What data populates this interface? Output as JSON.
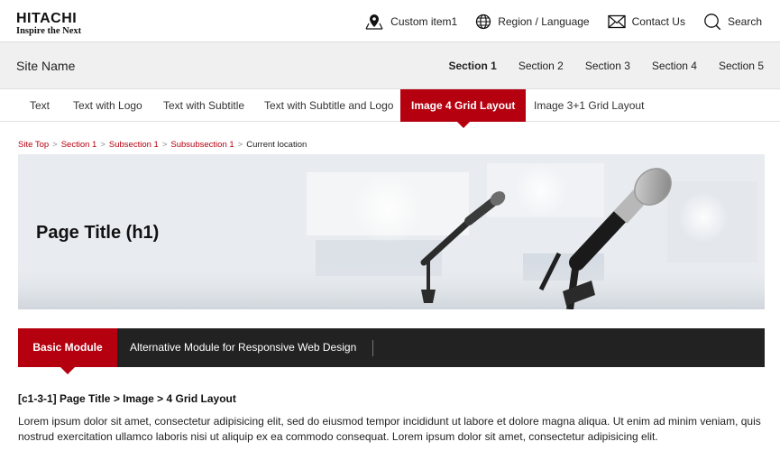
{
  "header": {
    "logo_line1": "HITACHI",
    "logo_line2": "Inspire the Next",
    "utility": [
      {
        "label": "Custom item1",
        "icon": "map-pin-icon"
      },
      {
        "label": "Region / Language",
        "icon": "globe-icon"
      },
      {
        "label": "Contact Us",
        "icon": "mail-icon"
      },
      {
        "label": "Search",
        "icon": "search-icon"
      }
    ]
  },
  "site": {
    "name": "Site Name",
    "sections": [
      "Section 1",
      "Section 2",
      "Section 3",
      "Section 4",
      "Section 5"
    ],
    "active_section": "Section 1"
  },
  "subtabs": [
    "Text",
    "Text with Logo",
    "Text with Subtitle",
    "Text with Subtitle and Logo",
    "Image 4 Grid Layout",
    "Image 3+1 Grid Layout"
  ],
  "active_subtab": "Image 4 Grid Layout",
  "breadcrumb": [
    "Site Top",
    "Section 1",
    "Subsection 1",
    "Subsubsection 1",
    "Current location"
  ],
  "hero": {
    "title": "Page Title (h1)"
  },
  "module_tabs": {
    "active": "Basic Module",
    "alt": "Alternative Module for Responsive Web Design"
  },
  "content": {
    "heading": "[c1-3-1] Page Title > Image > 4 Grid Layout",
    "paragraph": "Lorem ipsum dolor sit amet, consectetur adipisicing elit, sed do eiusmod tempor incididunt ut labore et dolore magna aliqua. Ut enim ad minim veniam, quis nostrud exercitation ullamco laboris nisi ut aliquip ex ea commodo consequat. Lorem ipsum dolor sit amet, consectetur adipisicing elit."
  },
  "colors": {
    "accent": "#b4000f",
    "dark_bar": "#222222",
    "site_bar": "#f0f0f0"
  }
}
